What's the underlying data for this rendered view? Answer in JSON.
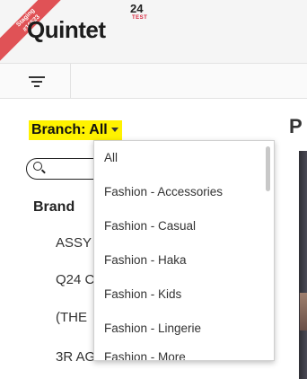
{
  "header": {
    "ribbon_line1": "Staging",
    "ribbon_line2": "#16523",
    "logo_text": "Quintet",
    "logo_super": "24",
    "logo_badge": "TEST"
  },
  "toolbar": {
    "filter_icon": "filter-lines-icon"
  },
  "branch_selector": {
    "label": "Branch: All",
    "highlight_color": "#fff200"
  },
  "search": {
    "icon": "search-icon",
    "value": ""
  },
  "brand_list": {
    "title": "Brand",
    "items": [
      "ASSY",
      "Q24 C",
      "(THE",
      "3R AG"
    ]
  },
  "right_panel": {
    "title": "P"
  },
  "dropdown": {
    "options": [
      "All",
      "Fashion - Accessories",
      "Fashion - Casual",
      "Fashion - Haka",
      "Fashion - Kids",
      "Fashion - Lingerie",
      "Fashion - More"
    ]
  }
}
